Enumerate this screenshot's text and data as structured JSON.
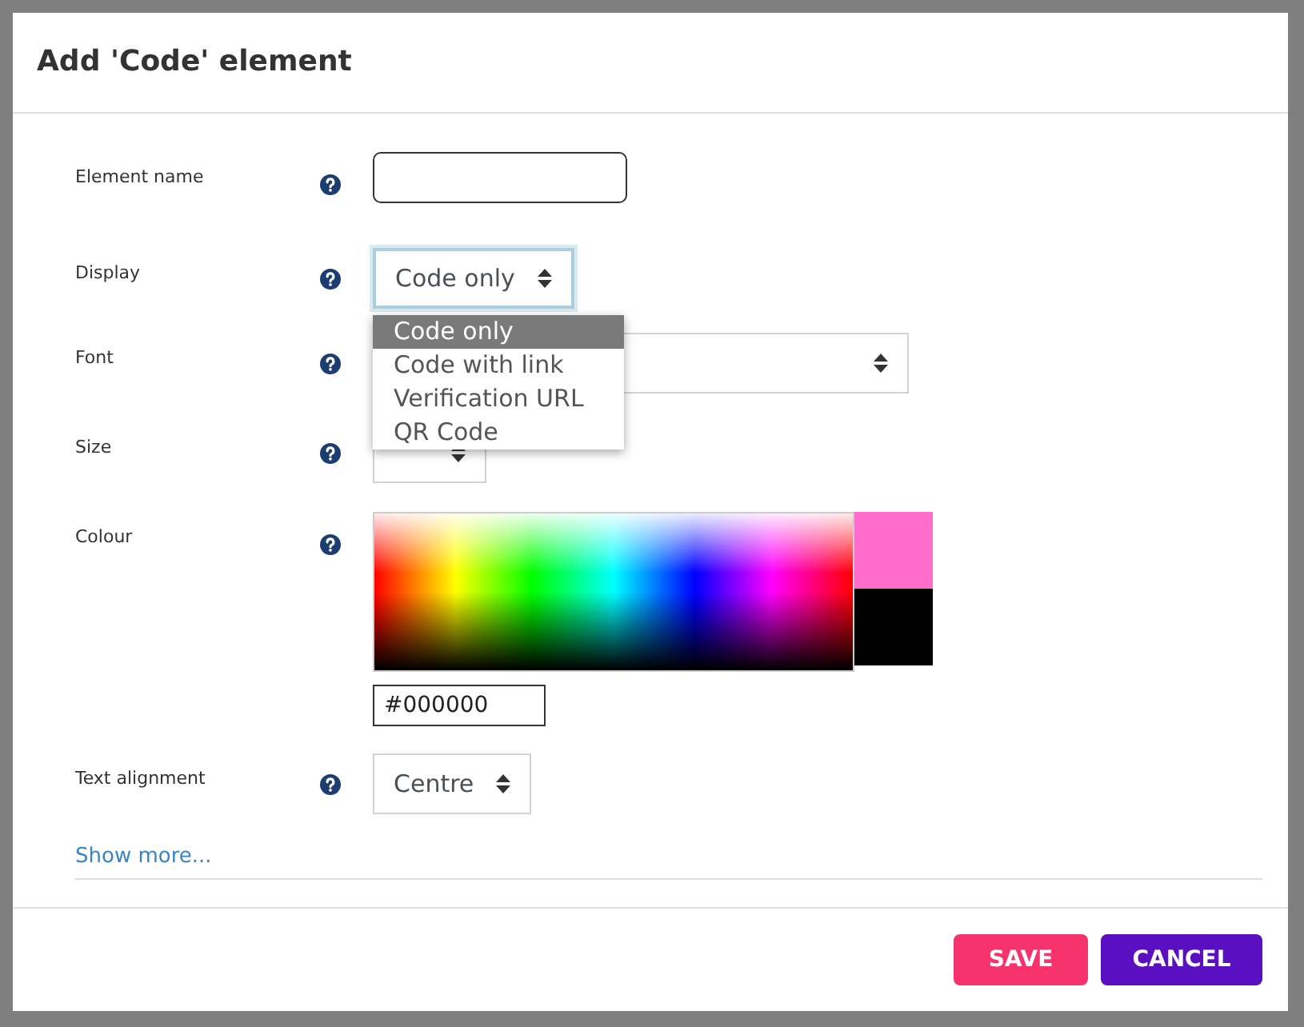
{
  "dialog": {
    "title": "Add 'Code' element"
  },
  "fields": [
    {
      "kind": "text",
      "label": "Element name"
    },
    {
      "kind": "select",
      "label": "Display",
      "value": "Code only",
      "focused": true,
      "expanded": true,
      "options": [
        {
          "label": "Code only",
          "selected": true
        },
        {
          "label": "Code with link",
          "selected": false
        },
        {
          "label": "Verification URL",
          "selected": false
        },
        {
          "label": "QR Code",
          "selected": false
        }
      ]
    },
    {
      "kind": "select",
      "label": "Font",
      "wide": true
    },
    {
      "kind": "select",
      "label": "Size"
    },
    {
      "kind": "colour",
      "label": "Colour",
      "swatches": [
        {
          "color": "#ff6ccc"
        },
        {
          "color": "#000000"
        }
      ],
      "value": "#000000"
    },
    {
      "kind": "select",
      "label": "Text alignment",
      "value": "Centre"
    }
  ],
  "show_more": "Show more...",
  "buttons": [
    {
      "label": "SAVE",
      "kind": "primary"
    },
    {
      "label": "CANCEL",
      "kind": "secondary"
    }
  ]
}
